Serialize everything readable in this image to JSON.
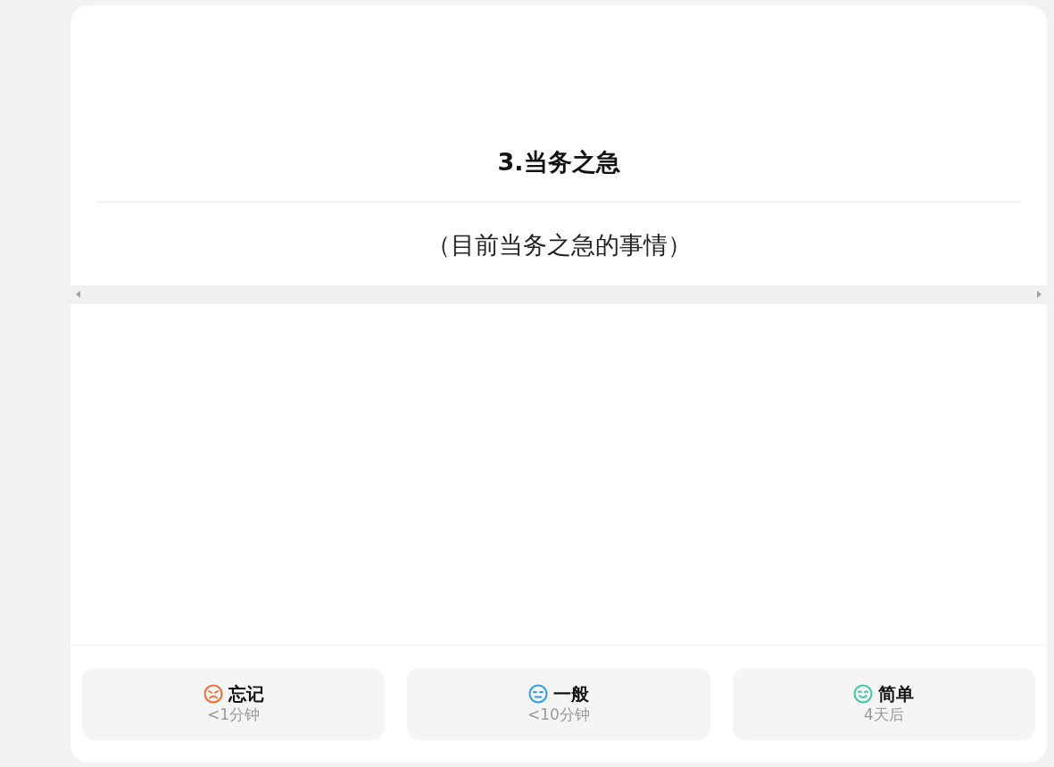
{
  "card": {
    "title": "3.当务之急",
    "subtitle": "（目前当务之急的事情）"
  },
  "answers": [
    {
      "kind": "sad",
      "color": "#f26b2e",
      "label": "忘记",
      "interval": "<1分钟"
    },
    {
      "kind": "neutral",
      "color": "#2b9af3",
      "label": "一般",
      "interval": "<10分钟"
    },
    {
      "kind": "happy",
      "color": "#3cc8a0",
      "label": "简单",
      "interval": "4天后"
    }
  ]
}
